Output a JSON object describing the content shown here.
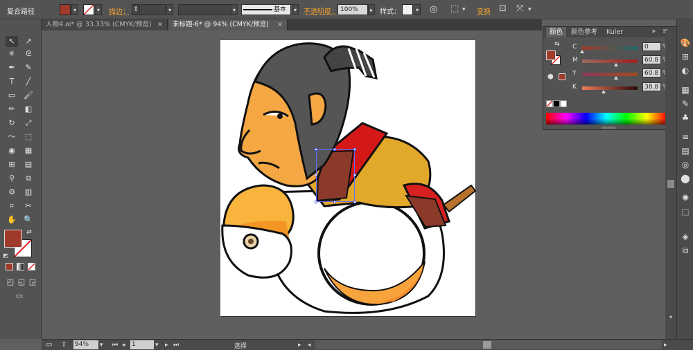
{
  "control_bar": {
    "object_type": "复合路径",
    "stroke_label": "描边：",
    "stroke_profile_label": "基本",
    "opacity_label": "不透明度：",
    "opacity_value": "100%",
    "style_label": "样式：",
    "transform_label": "变换",
    "fill_color": "#a03a2a"
  },
  "tabs": [
    {
      "label": "人物4.ai* @ 33.33% (CMYK/预览)",
      "active": false
    },
    {
      "label": "未标题-6* @ 94% (CMYK/预览)",
      "active": true
    }
  ],
  "tab_close": "×",
  "color_panel": {
    "tabs": [
      "颜色",
      "颜色参考",
      "Kuler"
    ],
    "active_tab": "颜色",
    "channels": [
      {
        "name": "C",
        "value": "0",
        "fraction": 0.0
      },
      {
        "name": "M",
        "value": "60.8",
        "fraction": 0.608
      },
      {
        "name": "Y",
        "value": "60.8",
        "fraction": 0.608
      },
      {
        "name": "K",
        "value": "38.8",
        "fraction": 0.388
      }
    ],
    "percent_sign": "%",
    "current_color": "#a03a2a"
  },
  "status_bar": {
    "zoom": "94%",
    "page": "1",
    "mode": "选择"
  }
}
